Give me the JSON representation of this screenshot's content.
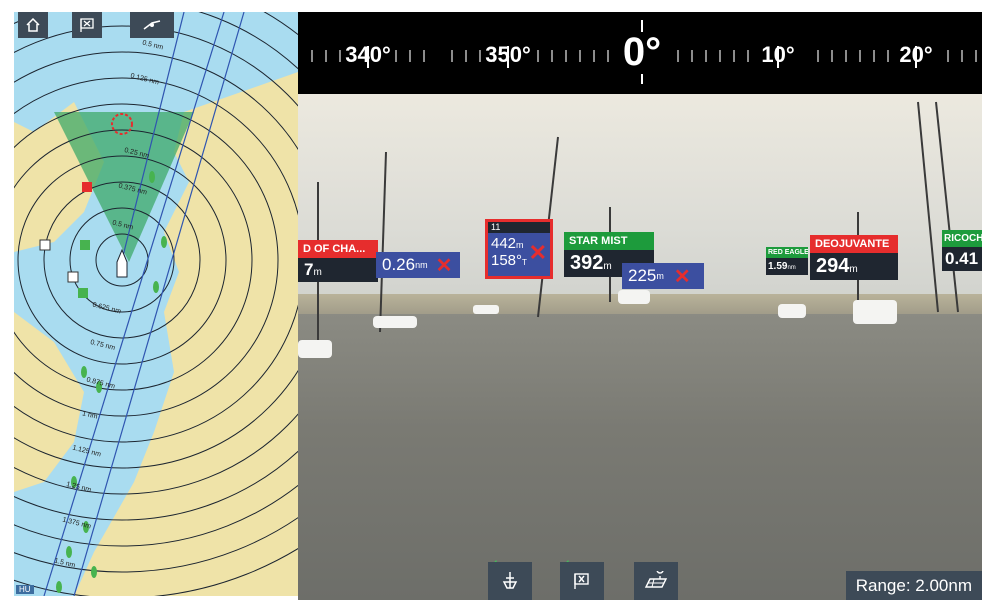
{
  "chart_pane": {
    "buttons": {
      "home": "home-icon",
      "waypoint": "waypoint-icon",
      "center": "center-vessel-icon"
    },
    "range_rings": [
      "0.5 nm",
      "0.125 nm",
      "0.25 nm",
      "0.375 nm",
      "0.5 nm",
      "0.625 nm",
      "0.75 nm",
      "0.875 nm",
      "1 nm",
      "1.125 nm",
      "1.25 nm",
      "1.375 nm",
      "1.5 nm"
    ],
    "orientation": "HU",
    "colors": {
      "water": "#a9dcf0",
      "land": "#efe3a8",
      "sector": "#3fa96a"
    }
  },
  "camera_pane": {
    "compass": {
      "headings": [
        "340°",
        "350°",
        "0°",
        "10°",
        "20°"
      ]
    },
    "targets": {
      "star_mist": {
        "name": "STAR MIST",
        "value": "392",
        "unit": "m"
      },
      "deojuvante": {
        "name": "DEOJUVANTE",
        "value": "294",
        "unit": "m"
      },
      "red_eagle": {
        "name": "RED EAGLE",
        "value": "1.59",
        "unit": "nm"
      },
      "ricochet": {
        "name": "RICOCH",
        "value": "0.41"
      },
      "spirit_of_cha": {
        "name": "D OF CHA...",
        "value": "7",
        "unit": "m"
      },
      "unnamed_a": {
        "value": "0.26",
        "unit": "nm"
      },
      "unnamed_b": {
        "value": "225",
        "unit": "m"
      },
      "selected": {
        "id": "11",
        "distance": "442",
        "distance_unit": "m",
        "bearing": "158°",
        "bearing_unit": "T"
      }
    },
    "bottom_controls": {
      "vessel": "vessel-icon",
      "waypoint": "waypoint-icon",
      "chart": "chart-icon"
    },
    "range": "Range: 2.00nm"
  }
}
